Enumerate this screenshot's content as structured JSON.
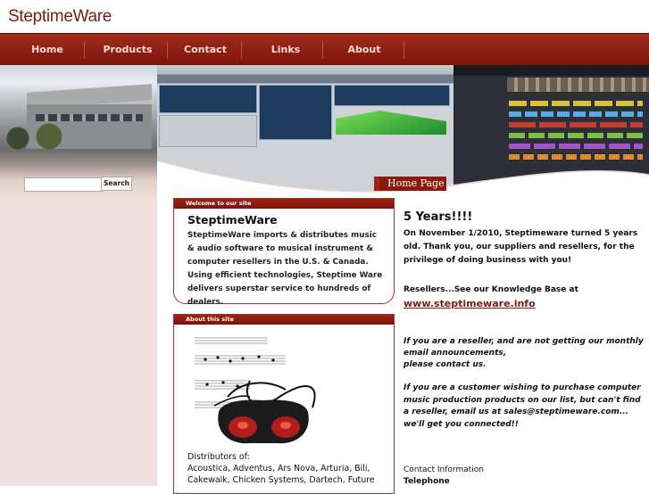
{
  "site": {
    "logo": "SteptimeWare"
  },
  "nav": {
    "items": [
      "Home",
      "Products",
      "Contact",
      "Links",
      "About"
    ]
  },
  "search": {
    "button": "Search",
    "placeholder": ""
  },
  "home_page_button": "Home Page",
  "welcome": {
    "title": "Welcome to our site",
    "heading": "SteptimeWare",
    "body": "SteptimeWare imports & distributes music & audio software to musical instrument & computer resellers in the U.S. & Canada. Using efficient technologies, Steptime Ware delivers superstar service to hundreds of dealers."
  },
  "about": {
    "title": "About this site",
    "distributors_label": "Distributors of:",
    "distributors": "Acoustica, Adventus, Ars Nova, Arturia, Bili, Cakewalk, Chicken Systems, Dartech, Future"
  },
  "news": {
    "heading": "5 Years!!!!",
    "p1": "On November 1/2010, Steptimeware turned 5 years old. Thank you, our suppliers and resellers, for the privilege of doing business with you!",
    "resellers_line": "Resellers...See our Knowledge Base at",
    "kb_link": "www.steptimeware.info",
    "p2a": "If you are a reseller, and are not getting our monthly email announcements,",
    "p2b": "please contact us.",
    "p3": "If you are a customer wishing to purchase computer music production products on our list, but can't find a reseller, email us at sales@steptimeware.com... we'll get you connected!!",
    "contact_label": "Contact Information",
    "telephone_label": "Telephone"
  },
  "colors": {
    "brand": "#8a1a10",
    "nav_text": "#f4dcd2",
    "sidebar": "#f0e2de",
    "link": "#7a1a12"
  },
  "icons": {
    "home_page_button_icon": "page-arrow-icon"
  }
}
